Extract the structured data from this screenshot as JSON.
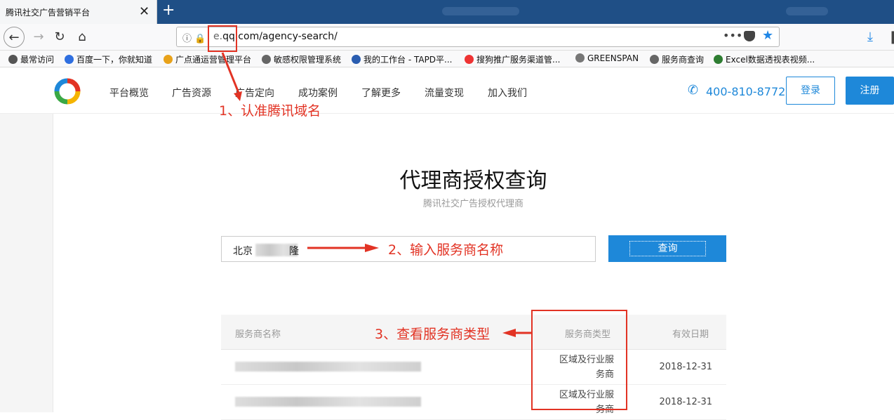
{
  "browser": {
    "tab_title": "腾讯社交广告营销平台",
    "tab_close": "✕",
    "new_tab": "+",
    "url_prefix": "e.",
    "url_domain": "qq",
    "url_suffix": ".com/agency-search/",
    "url_menu": "•••",
    "bookmarks": [
      {
        "label": "最常访问",
        "icon_color": "#555"
      },
      {
        "label": "百度一下，你就知道",
        "icon_color": "#2f6fe0"
      },
      {
        "label": "广点通运营管理平台",
        "icon_color": "#e8a21a"
      },
      {
        "label": "敏感权限管理系统",
        "icon_color": "#666"
      },
      {
        "label": "我的工作台 - TAPD平...",
        "icon_color": "#2a5db0"
      },
      {
        "label": "搜狗推广服务渠道管...",
        "icon_color": "#e33"
      },
      {
        "label": "GREENSPAN",
        "icon_color": "#777"
      },
      {
        "label": "服务商查询",
        "icon_color": "#666"
      },
      {
        "label": "Excel数据透视表视频...",
        "icon_color": "#2e7d32"
      }
    ]
  },
  "site": {
    "nav": [
      "平台概览",
      "广告资源",
      "广告定向",
      "成功案例",
      "了解更多",
      "流量变现",
      "加入我们"
    ],
    "phone": "400-810-8772",
    "login": "登录",
    "register": "注册"
  },
  "page": {
    "title": "代理商授权查询",
    "subtitle": "腾讯社交广告授权代理商",
    "search_value": "北京",
    "search_tail": "隆",
    "search_button": "查询"
  },
  "table": {
    "headers": [
      "服务商名称",
      "服务商类型",
      "有效日期"
    ],
    "rows": [
      {
        "type": "区域及行业服务商",
        "date": "2018-12-31"
      },
      {
        "type": "区域及行业服务商",
        "date": "2018-12-31"
      }
    ]
  },
  "annotations": {
    "step1": "1、认准腾讯域名",
    "step2": "2、输入服务商名称",
    "step3": "3、查看服务商类型"
  },
  "colors": {
    "accent": "#1e88d9",
    "annotation": "#e23324"
  }
}
